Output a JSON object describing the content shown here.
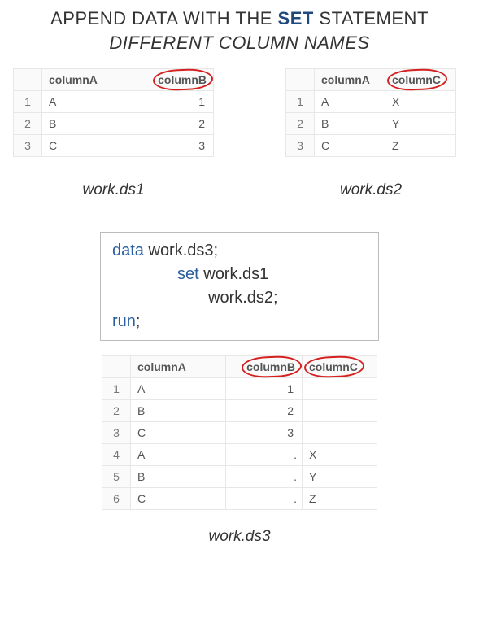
{
  "title": {
    "line1_pre": "APPEND DATA WITH THE ",
    "line1_set": "SET",
    "line1_post": " STATEMENT",
    "line2": "DIFFERENT COLUMN NAMES"
  },
  "ds1": {
    "label": "work.ds1",
    "headers": {
      "a": "columnA",
      "b": "columnB"
    },
    "rows": [
      {
        "n": "1",
        "a": "A",
        "b": "1"
      },
      {
        "n": "2",
        "a": "B",
        "b": "2"
      },
      {
        "n": "3",
        "a": "C",
        "b": "3"
      }
    ]
  },
  "ds2": {
    "label": "work.ds2",
    "headers": {
      "a": "columnA",
      "c": "columnC"
    },
    "rows": [
      {
        "n": "1",
        "a": "A",
        "c": "X"
      },
      {
        "n": "2",
        "a": "B",
        "c": "Y"
      },
      {
        "n": "3",
        "a": "C",
        "c": "Z"
      }
    ]
  },
  "code": {
    "data_kw": "data",
    "data_arg": " work.ds3;",
    "set_kw": "set",
    "set_arg1": " work.ds1",
    "set_arg2": "work.ds2;",
    "run_kw": "run",
    "run_post": ";"
  },
  "ds3": {
    "label": "work.ds3",
    "headers": {
      "a": "columnA",
      "b": "columnB",
      "c": "columnC"
    },
    "rows": [
      {
        "n": "1",
        "a": "A",
        "b": "1",
        "c": ""
      },
      {
        "n": "2",
        "a": "B",
        "b": "2",
        "c": ""
      },
      {
        "n": "3",
        "a": "C",
        "b": "3",
        "c": ""
      },
      {
        "n": "4",
        "a": "A",
        "b": ".",
        "c": "X"
      },
      {
        "n": "5",
        "a": "B",
        "b": ".",
        "c": "Y"
      },
      {
        "n": "6",
        "a": "C",
        "b": ".",
        "c": "Z"
      }
    ]
  }
}
